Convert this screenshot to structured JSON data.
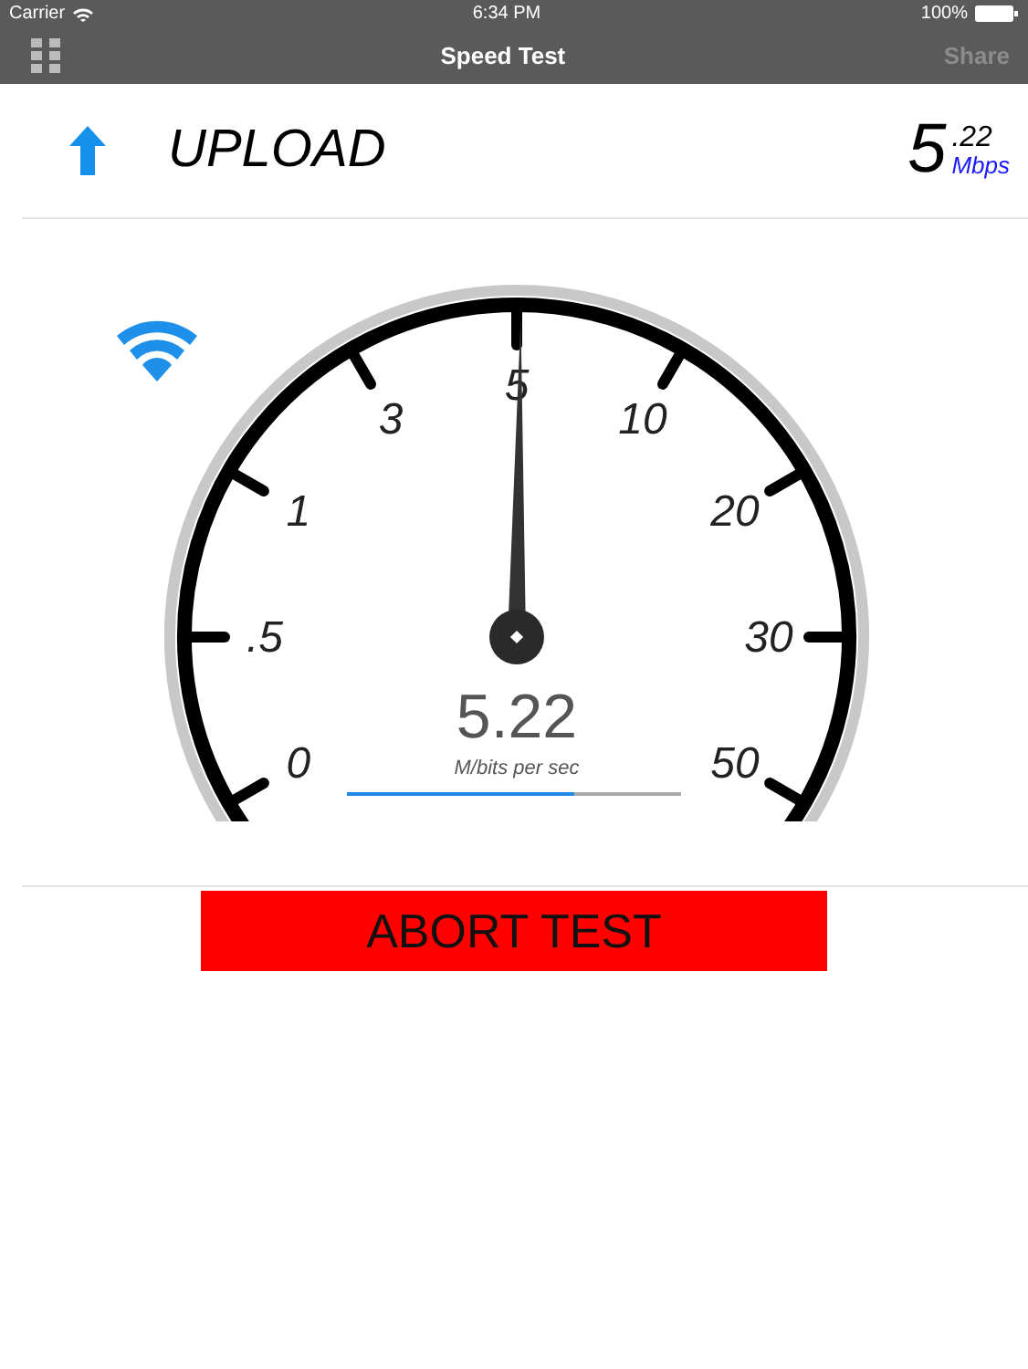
{
  "status_bar": {
    "carrier": "Carrier",
    "time": "6:34 PM",
    "battery": "100%"
  },
  "nav_bar": {
    "title": "Speed Test",
    "share": "Share"
  },
  "header": {
    "mode": "UPLOAD",
    "speed_whole": "5",
    "speed_fraction": ".22",
    "unit": "Mbps"
  },
  "gauge": {
    "ticks": [
      "0",
      ".5",
      "1",
      "3",
      "5",
      "10",
      "20",
      "30",
      "50"
    ],
    "needle": {
      "level": 0.503
    },
    "reading": "5.22",
    "unit": "M/bits per sec",
    "progress": {
      "level": 0.68
    }
  },
  "abort_button": "ABORT TEST"
}
